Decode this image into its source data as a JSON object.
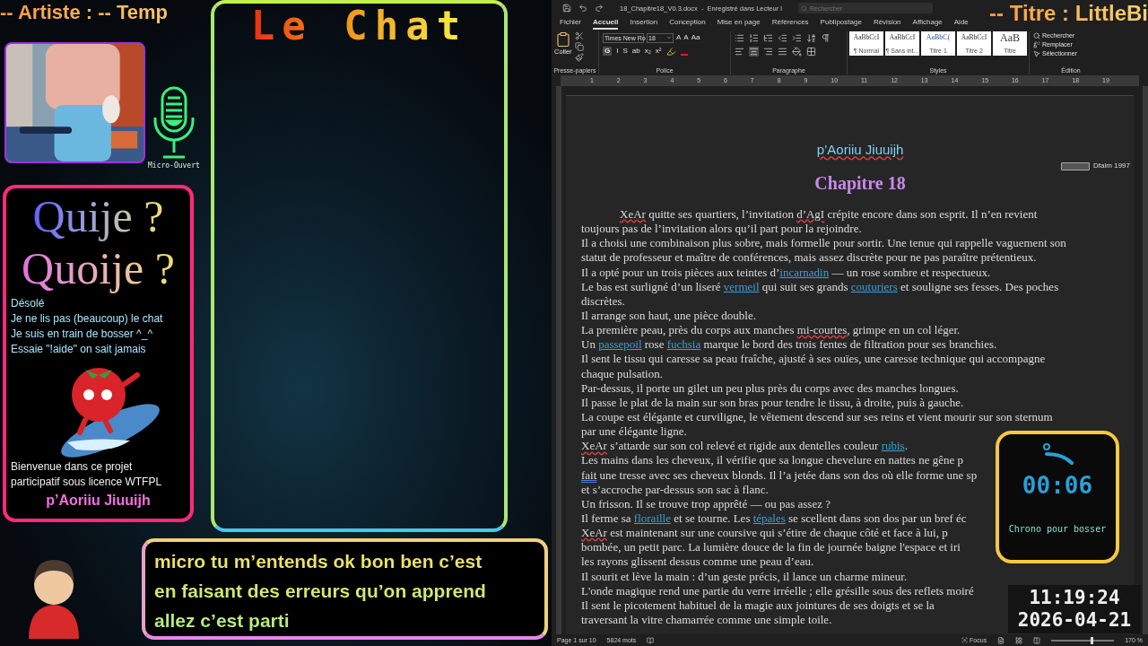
{
  "left_overlay": {
    "artist_banner": "-- Artiste :  -- Temp",
    "mic": {
      "label": "Micro-Ouvert"
    },
    "info_panel": {
      "title_lines": [
        "Quije ?",
        "Quoije ?"
      ],
      "message_lines": [
        "Désolé",
        "Je ne lis pas (beaucoup) le chat",
        "Je suis en train de bosser ^_^",
        "Essaie \"!aide\" on sait jamais"
      ],
      "welcome_lines": [
        "Bienvenue dans ce projet",
        "participatif sous licence WTFPL"
      ],
      "author": "p’Aoriiu Jiuuijh"
    },
    "chat": {
      "title": "Le Chat"
    },
    "subtitle_lines": [
      "micro tu m’entends ok bon ben c’est",
      "en faisant des erreurs qu’on apprend",
      "allez c’est parti"
    ]
  },
  "title_banner": "-- Titre : LittleBi",
  "word": {
    "file_title": "18_Chapitre18_V0.3.docx  -  Enregistré dans Lecteur l",
    "search": {
      "placeholder": "Rechercher"
    },
    "tabs": [
      {
        "label": "Fichier",
        "selected": false
      },
      {
        "label": "Accueil",
        "selected": true
      },
      {
        "label": "Insertion",
        "selected": false
      },
      {
        "label": "Conception",
        "selected": false
      },
      {
        "label": "Mise en page",
        "selected": false
      },
      {
        "label": "Références",
        "selected": false
      },
      {
        "label": "Publipostage",
        "selected": false
      },
      {
        "label": "Révision",
        "selected": false
      },
      {
        "label": "Affichage",
        "selected": false
      },
      {
        "label": "Aide",
        "selected": false
      }
    ],
    "ribbon": {
      "clipboard": {
        "paste": "Coller",
        "label": "Presse-papiers"
      },
      "font": {
        "family": "Times New Ro",
        "size": "18",
        "grow_buttons": [
          "A",
          "A",
          "Aa"
        ],
        "format_buttons": [
          "G",
          "I",
          "S",
          "ab",
          "x₂",
          "x²"
        ],
        "label": "Police"
      },
      "paragraph": {
        "label": "Paragraphe"
      },
      "styles": {
        "items": [
          {
            "preview": "AaBbCcI",
            "name": "¶ Normal"
          },
          {
            "preview": "AaBbCcI",
            "name": "¶ Sans int..."
          },
          {
            "preview": "AaBbC(",
            "name": "Titre 1"
          },
          {
            "preview": "AaBbCcI",
            "name": "Titre 2"
          },
          {
            "preview": "AaB",
            "name": "Titre"
          }
        ],
        "label": "Styles"
      },
      "editing": {
        "items": [
          "Rechercher",
          "Remplacer",
          "Sélectionner"
        ],
        "label": "Édition"
      }
    },
    "ruler": [
      "1",
      "2",
      "3",
      "4",
      "5",
      "6",
      "7",
      "8",
      "9",
      "10",
      "11",
      "12",
      "13",
      "14",
      "15",
      "16",
      "17",
      "18",
      "19"
    ],
    "document": {
      "author": "p’Aoriiu Jiuuijh",
      "license": "Dfalm 1997",
      "chapter": "Chapitre 18",
      "opening_line": {
        "segments": [
          {
            "text": "XeAr",
            "kind": "flagged"
          },
          {
            "text": " quitte ses quartiers, l’invitation ",
            "kind": "text"
          },
          {
            "text": "d’AgI",
            "kind": "flagged"
          },
          {
            "text": " crépite encore dans son esprit. Il n’en revient",
            "kind": "text"
          }
        ]
      },
      "lines": [
        {
          "segments": [
            {
              "text": "toujours pas de l’invitation alors qu’il part pour la rejoindre.",
              "kind": "text"
            }
          ]
        },
        {
          "segments": [
            {
              "text": "Il a choisi une combinaison plus sobre, mais formelle pour sortir. Une tenue qui rappelle vaguement son",
              "kind": "text"
            }
          ]
        },
        {
          "segments": [
            {
              "text": "statut de professeur et maître de conférences, mais assez discrète pour ne pas paraître prétentieux.",
              "kind": "text"
            }
          ]
        },
        {
          "segments": [
            {
              "text": "Il a opté pour un trois pièces aux teintes d’",
              "kind": "text"
            },
            {
              "text": "incarnadin",
              "kind": "link"
            },
            {
              "text": " — un rose sombre et respectueux.",
              "kind": "text"
            }
          ]
        },
        {
          "segments": [
            {
              "text": "Le bas est surligné d’un liseré ",
              "kind": "text"
            },
            {
              "text": "vermeil",
              "kind": "link"
            },
            {
              "text": " qui suit ses grands ",
              "kind": "text"
            },
            {
              "text": "couturiers",
              "kind": "link"
            },
            {
              "text": " et souligne ses fesses. Des poches",
              "kind": "text"
            }
          ]
        },
        {
          "segments": [
            {
              "text": "discrètes.",
              "kind": "text"
            }
          ]
        },
        {
          "segments": [
            {
              "text": "Il arrange son haut, une pièce double.",
              "kind": "text"
            }
          ]
        },
        {
          "segments": [
            {
              "text": "La première peau, près du corps aux manches ",
              "kind": "text"
            },
            {
              "text": "mi-courtes",
              "kind": "flagged"
            },
            {
              "text": ", grimpe en un col léger.",
              "kind": "text"
            }
          ]
        },
        {
          "segments": [
            {
              "text": "Un ",
              "kind": "text"
            },
            {
              "text": "passepoil",
              "kind": "link"
            },
            {
              "text": " rose ",
              "kind": "text"
            },
            {
              "text": "fuchsia",
              "kind": "link"
            },
            {
              "text": " marque le bord des trois fentes de filtration pour ses branchies.",
              "kind": "text"
            }
          ]
        },
        {
          "segments": [
            {
              "text": "Il sent le tissu qui caresse sa peau fraîche, ajusté à ses ouïes, une caresse technique qui accompagne",
              "kind": "text"
            }
          ]
        },
        {
          "segments": [
            {
              "text": "chaque pulsation.",
              "kind": "text"
            }
          ]
        },
        {
          "segments": [
            {
              "text": "Par-dessus, il porte un gilet un peu plus près du corps avec des manches longues.",
              "kind": "text"
            }
          ]
        },
        {
          "segments": [
            {
              "text": "Il passe le plat de la main sur son bras pour tendre le tissu, à droite, puis à gauche.",
              "kind": "text"
            }
          ]
        },
        {
          "segments": [
            {
              "text": "La coupe est élégante et curviligne, le vêtement descend sur ses reins et vient mourir sur son sternum",
              "kind": "text"
            }
          ]
        },
        {
          "segments": [
            {
              "text": "par une élégante ligne.",
              "kind": "text"
            }
          ]
        },
        {
          "segments": [
            {
              "text": "XeAr",
              "kind": "flagged"
            },
            {
              "text": " s’attarde sur son col relevé et rigide aux dentelles couleur ",
              "kind": "text"
            },
            {
              "text": "rubis",
              "kind": "link"
            },
            {
              "text": ".",
              "kind": "text"
            }
          ]
        },
        {
          "segments": [
            {
              "text": "Les mains dans les cheveux, il vérifie que sa longue chevelure en nattes ne gêne p",
              "kind": "text"
            }
          ]
        },
        {
          "segments": [
            {
              "text": "fait",
              "kind": "grammar"
            },
            {
              "text": " une tresse avec ses cheveux blonds. Il l’a jetée dans son dos où elle forme une sp",
              "kind": "text"
            }
          ]
        },
        {
          "segments": [
            {
              "text": "et s’accroche par-dessus son sac à flanc.",
              "kind": "text"
            }
          ]
        },
        {
          "segments": [
            {
              "text": "Un frisson. Il se trouve trop apprêté — ou pas assez ?",
              "kind": "text"
            }
          ]
        },
        {
          "segments": [
            {
              "text": "Il ferme sa ",
              "kind": "text"
            },
            {
              "text": "floraille",
              "kind": "link"
            },
            {
              "text": " et se tourne. Les ",
              "kind": "text"
            },
            {
              "text": "tépales",
              "kind": "link"
            },
            {
              "text": " se scellent dans son dos par un bref éc",
              "kind": "text"
            }
          ]
        },
        {
          "segments": [
            {
              "text": "XeAr",
              "kind": "flagged"
            },
            {
              "text": " est maintenant sur une coursive qui s’étire de chaque côté et face à lui, p",
              "kind": "text"
            }
          ]
        },
        {
          "segments": [
            {
              "text": "bombée, un petit parc. La lumière douce de la fin de journée baigne l'espace et iri",
              "kind": "text"
            }
          ]
        },
        {
          "segments": [
            {
              "text": "les rayons glissent dessus comme une peau d’eau.",
              "kind": "text"
            }
          ]
        },
        {
          "segments": [
            {
              "text": "Il sourit et lève la main : d’un geste précis, il lance un charme mineur.",
              "kind": "text"
            }
          ]
        },
        {
          "segments": [
            {
              "text": "L'onde magique rend une partie du verre irréelle ; elle grésille sous des reflets moiré",
              "kind": "text"
            }
          ]
        },
        {
          "segments": [
            {
              "text": "Il sent le picotement habituel de la magie aux jointures de ses doigts et se la",
              "kind": "text"
            }
          ]
        },
        {
          "segments": [
            {
              "text": "traversant la vitre chamarrée comme une simple toile.",
              "kind": "text"
            }
          ]
        }
      ]
    },
    "status": {
      "page": "Page 1 sur 10",
      "words": "5824 mots",
      "focus": "Focus",
      "zoom": "170 %",
      "zoom_slider": {
        "level": 0.62
      }
    }
  },
  "chrono": {
    "time": "00:06",
    "label": "Chrono pour bosser"
  },
  "clock": {
    "time": "11:19:24",
    "date": "2026-04-21"
  }
}
